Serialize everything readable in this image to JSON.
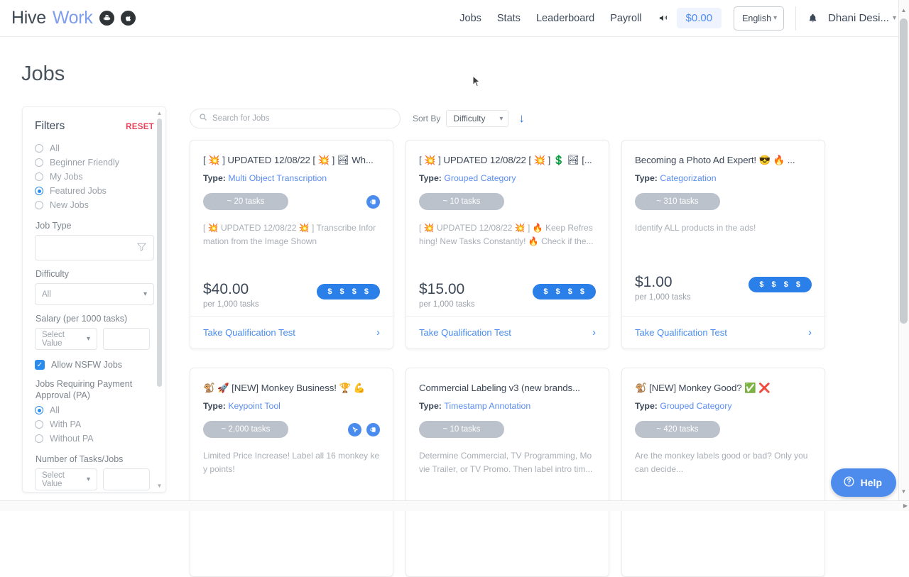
{
  "header": {
    "logo_primary": "Hive",
    "logo_secondary": "Work",
    "badges": [
      {
        "name": "android-icon",
        "label": "Android"
      },
      {
        "name": "apple-icon",
        "label": "Apple"
      }
    ],
    "nav_links": [
      "Jobs",
      "Stats",
      "Leaderboard",
      "Payroll"
    ],
    "megaphone_icon": "megaphone-icon",
    "balance": "$0.00",
    "language": "English",
    "bell_icon": "bell-icon",
    "user_name": "Dhani Desi..."
  },
  "page": {
    "title": "Jobs"
  },
  "filters": {
    "title": "Filters",
    "reset_label": "RESET",
    "scope_options": [
      {
        "label": "All",
        "selected": false
      },
      {
        "label": "Beginner Friendly",
        "selected": false
      },
      {
        "label": "My Jobs",
        "selected": false
      },
      {
        "label": "Featured Jobs",
        "selected": true
      },
      {
        "label": "New Jobs",
        "selected": false
      }
    ],
    "job_type": {
      "label": "Job Type",
      "value": "",
      "icon": "funnel-icon"
    },
    "difficulty": {
      "label": "Difficulty",
      "value": "All"
    },
    "salary": {
      "label": "Salary (per 1000 tasks)",
      "select_value": "Select Value",
      "amount": ""
    },
    "nsfw": {
      "label": "Allow NSFW Jobs",
      "checked": true
    },
    "payment_approval": {
      "label": "Jobs Requiring Payment Approval (PA)",
      "options": [
        {
          "label": "All",
          "selected": true
        },
        {
          "label": "With PA",
          "selected": false
        },
        {
          "label": "Without PA",
          "selected": false
        }
      ]
    },
    "tasks_count": {
      "label": "Number of Tasks/Jobs",
      "select_value": "Select Value",
      "amount": ""
    }
  },
  "search": {
    "placeholder": "Search for Jobs",
    "value": "",
    "icon": "search-icon"
  },
  "sort": {
    "label": "Sort By",
    "value": "Difficulty",
    "direction_icon": "arrow-down-icon"
  },
  "jobs": [
    {
      "title": "[ 💥 ] UPDATED 12/08/22 [ 💥 ] 🏞 Wh...",
      "title_prefix": "[",
      "title_text": "UPDATED 12/08/22",
      "type_label": "Type:",
      "type_value": "Multi Object Transcription",
      "tasks": "~ 20 tasks",
      "badges": [
        "hand-pointer-icon"
      ],
      "description": "[ 💥 UPDATED 12/08/22 💥 ] Transcribe Information from the Image Shown",
      "price": "$40.00",
      "price_sub": "per 1,000 tasks",
      "pay_rating": "$ $ $ $",
      "action": "Take Qualification Test"
    },
    {
      "title": "[ 💥 ] UPDATED 12/08/22 [ 💥 ] 💲 🏞 [...",
      "type_label": "Type:",
      "type_value": "Grouped Category",
      "tasks": "~ 10 tasks",
      "badges": [],
      "description": "[ 💥 UPDATED 12/08/22 💥 ] 🔥 Keep Refreshing! New Tasks Constantly! 🔥 Check if the...",
      "price": "$15.00",
      "price_sub": "per 1,000 tasks",
      "pay_rating": "$ $ $ $",
      "action": "Take Qualification Test"
    },
    {
      "title": "Becoming a Photo Ad Expert! 😎 🔥 ...",
      "type_label": "Type:",
      "type_value": "Categorization",
      "tasks": "~ 310 tasks",
      "badges": [],
      "description": "Identify ALL products in the ads!",
      "price": "$1.00",
      "price_sub": "per 1,000 tasks",
      "pay_rating": "$ $ $ $",
      "action": "Take Qualification Test"
    },
    {
      "title": "🐒 🚀 [NEW] Monkey Business! 🏆 💪",
      "type_label": "Type:",
      "type_value": "Keypoint Tool",
      "tasks": "~ 2,000 tasks",
      "badges": [
        "keypoint-cursor-icon",
        "hand-pointer-icon"
      ],
      "description": "Limited Price Increase! Label all 16 monkey key points!",
      "price": "",
      "price_sub": "",
      "pay_rating": "",
      "action": ""
    },
    {
      "title": "Commercial Labeling v3 (new brands...",
      "type_label": "Type:",
      "type_value": "Timestamp Annotation",
      "tasks": "~ 10 tasks",
      "badges": [],
      "description": "Determine Commercial, TV Programming, Movie Trailer, or TV Promo. Then label intro tim...",
      "price": "",
      "price_sub": "",
      "pay_rating": "",
      "action": ""
    },
    {
      "title": "🐒 [NEW] Monkey Good? ✅ ❌",
      "type_label": "Type:",
      "type_value": "Grouped Category",
      "tasks": "~ 420 tasks",
      "badges": [],
      "description": "Are the monkey labels good or bad? Only you can decide...",
      "price": "",
      "price_sub": "",
      "pay_rating": "",
      "action": ""
    }
  ],
  "help": {
    "label": "Help",
    "icon": "question-circle-icon"
  },
  "colors": {
    "accent_blue": "#4a8ced",
    "link_blue": "#5b8def",
    "reset_red": "#e8415a",
    "pill_grey": "#b9c0c9",
    "text_dark": "#3c4858",
    "text_muted": "#a8aeb5"
  }
}
